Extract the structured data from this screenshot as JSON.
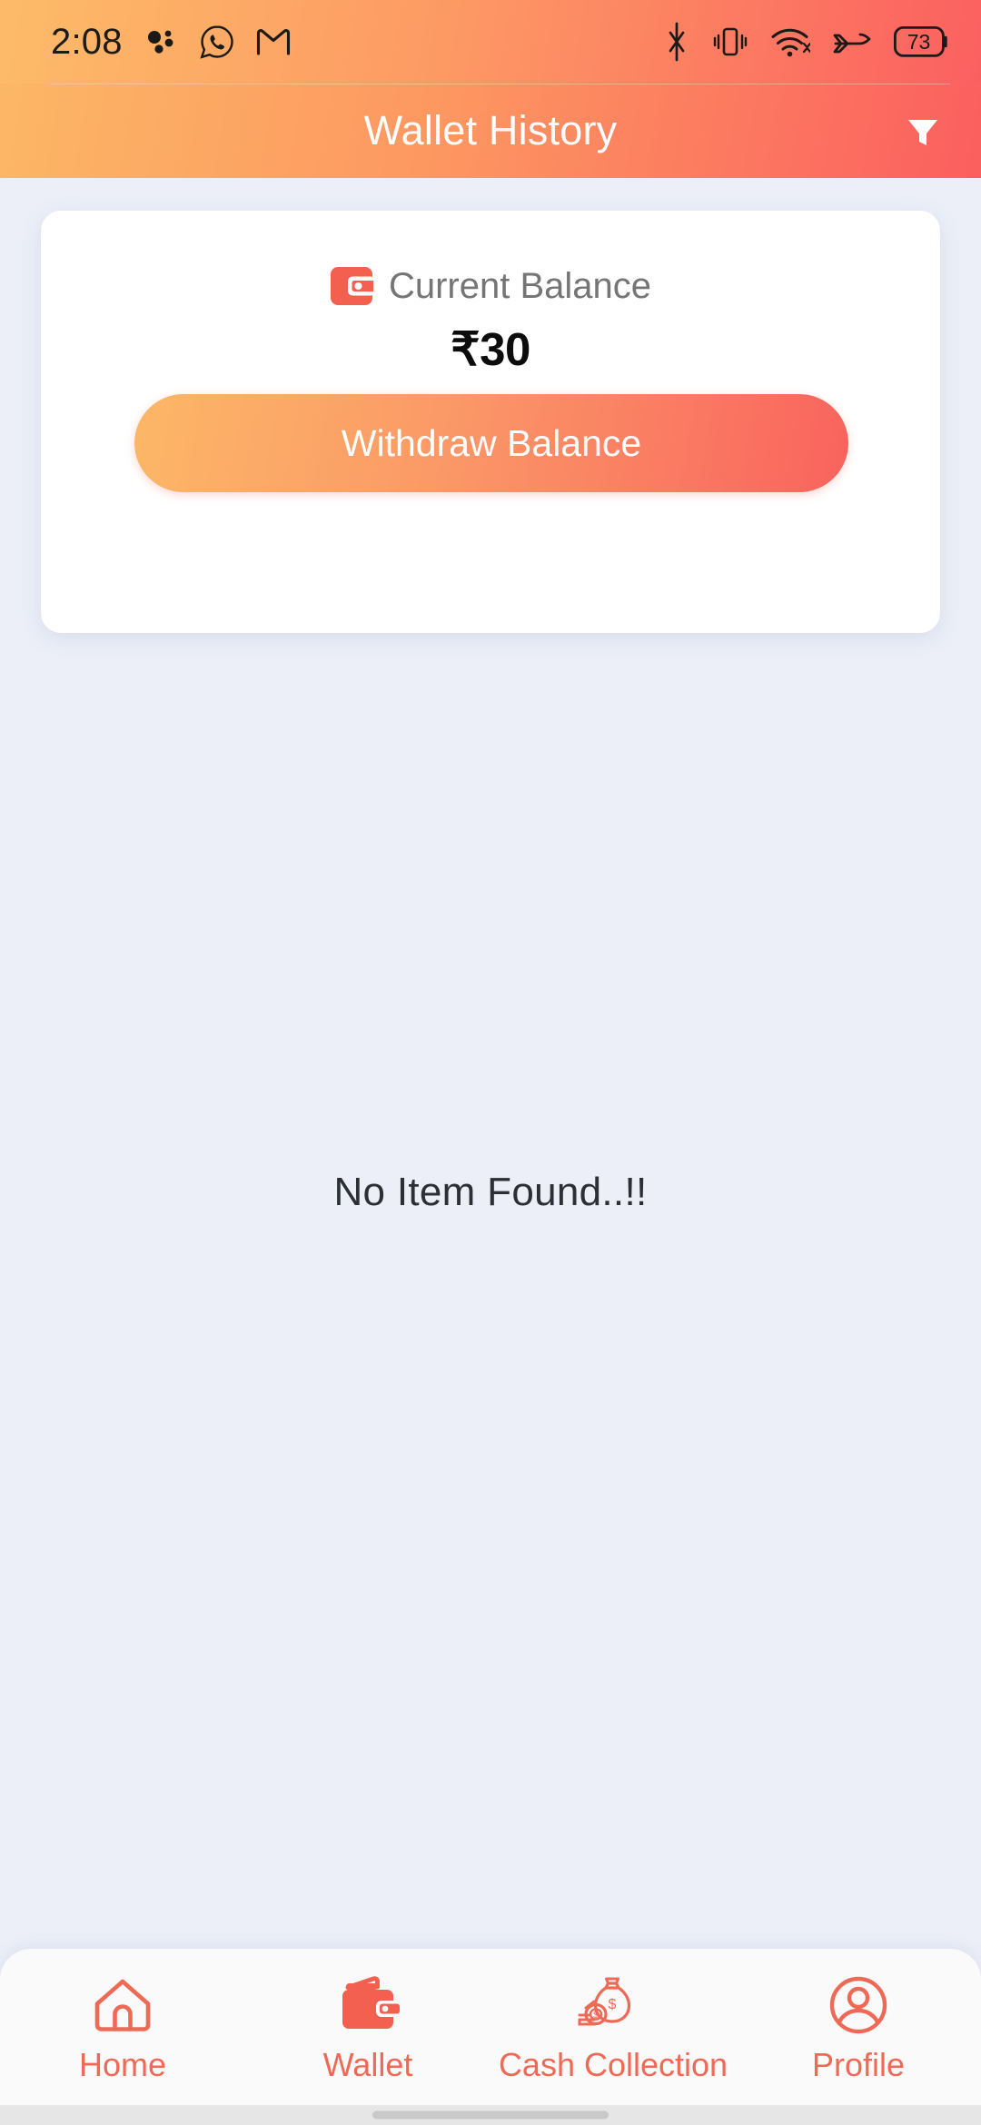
{
  "theme": {
    "gradient_start": "#fcb765",
    "gradient_mid": "#fd9761",
    "gradient_end": "#fb5f5f",
    "page_background": "#eceff8",
    "card_background": "#ffffff",
    "accent_red": "#f4604f",
    "nav_label_color": "#ef6a56",
    "nav_background": "#fafafa",
    "label_gray": "#757575",
    "empty_text_color": "#2c2f36"
  },
  "statusbar": {
    "time": "2:08",
    "notification_icons": [
      "dots-cluster-icon",
      "whatsapp-icon",
      "gmail-icon"
    ],
    "system_icons": [
      "bluetooth-icon",
      "vibrate-icon",
      "wifi-icon",
      "airplane-mode-icon",
      "battery-icon"
    ],
    "battery_percent": "73"
  },
  "appbar": {
    "title": "Wallet History",
    "filter_icon": "filter-funnel-icon"
  },
  "balance_card": {
    "wallet_icon": "wallet-icon",
    "label": "Current Balance",
    "amount": "₹30",
    "currency_symbol": "₹",
    "amount_value": "30",
    "withdraw_label": "Withdraw Balance"
  },
  "content": {
    "empty_message": "No Item Found..!!"
  },
  "bottomnav": {
    "active_index": 1,
    "items": [
      {
        "label": "Home",
        "icon": "home-icon",
        "active": false
      },
      {
        "label": "Wallet",
        "icon": "wallet-filled-icon",
        "active": true
      },
      {
        "label": "Cash Collection",
        "icon": "money-bag-icon",
        "active": false
      },
      {
        "label": "Profile",
        "icon": "person-circle-icon",
        "active": false
      }
    ]
  }
}
